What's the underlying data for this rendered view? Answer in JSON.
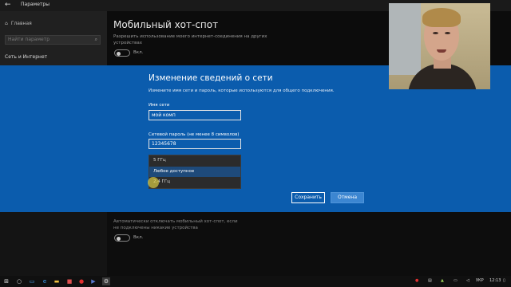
{
  "app": {
    "title": "Параметры",
    "back_glyph": "←"
  },
  "sidebar": {
    "home": "Главная",
    "home_icon": "home-icon",
    "search_placeholder": "Найти параметр",
    "section": "Сеть и Интернет"
  },
  "main": {
    "title": "Мобильный хот-спот",
    "description": "Разрешить использование моего интернет-соединения на других устройствах",
    "toggle_top_label": "Вкл.",
    "auto_off_text": "Автоматически отключать мобильный хот-спот, если не подключены никакие устройства",
    "toggle_bottom_label": "Вкл."
  },
  "dialog": {
    "title": "Изменение сведений о сети",
    "description": "Измените имя сети и пароль, которые используются для общего подключения.",
    "network_name_label": "Имя сети",
    "network_name_value": "мой комп",
    "password_label": "Сетевой пароль (не менее 8 символов)",
    "password_value": "12345678",
    "band_options": [
      "5 ГГц",
      "Любое доступное",
      "2,4 ГГц"
    ],
    "hovered_option_index": 1,
    "save_label": "Сохранить",
    "cancel_label": "Отмена"
  },
  "taskbar": {
    "language": "УКР",
    "time": "12:13",
    "icons": [
      "windows-icon",
      "search-icon",
      "task-view-icon",
      "edge-icon",
      "explorer-icon",
      "store-icon",
      "opera-icon",
      "media-icon",
      "app-icon",
      "photoshop-icon",
      "settings-icon"
    ]
  },
  "colors": {
    "dialog_bg": "#0b5cad",
    "accent_button": "#3c86d1",
    "dropdown_hover": "#1e4a7a"
  }
}
